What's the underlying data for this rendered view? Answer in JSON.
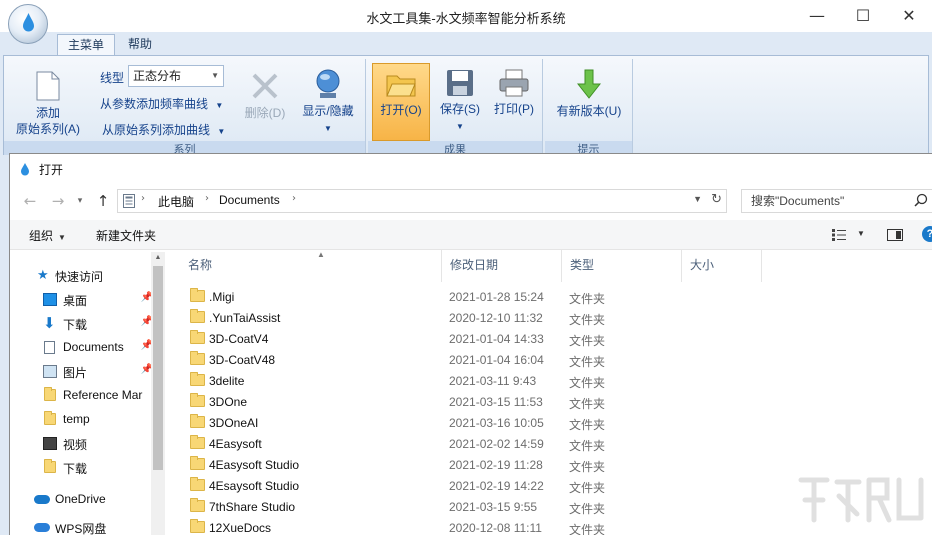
{
  "app": {
    "title": "水文工具集-水文频率智能分析系统",
    "window_controls": {
      "minimize": "—",
      "maximize": "☐",
      "close": "✕"
    },
    "tabs": [
      {
        "label": "主菜单",
        "active": true
      },
      {
        "label": "帮助",
        "active": false
      }
    ],
    "ribbon": {
      "add_button": {
        "line1": "添加",
        "line2": "原始系列(A)"
      },
      "line_type_label": "线型",
      "line_type_value": "正态分布",
      "add_from_params": "从参数添加频率曲线",
      "add_from_series": "从原始系列添加曲线",
      "delete_button": "删除(D)",
      "show_hide_button": "显示/隐藏",
      "group_series": "系列",
      "open_button": "打开(O)",
      "save_button": "保存(S)",
      "print_button": "打印(P)",
      "group_results": "成果",
      "update_button": "有新版本(U)",
      "group_tips": "提示"
    }
  },
  "dialog": {
    "title": "打开",
    "breadcrumb": [
      "此电脑",
      "Documents"
    ],
    "search_placeholder": "搜索\"Documents\"",
    "organize_label": "组织",
    "new_folder_label": "新建文件夹",
    "nav_pane": {
      "items": [
        {
          "label": "快速访问",
          "icon": "star-icon",
          "pinned": false
        },
        {
          "label": "桌面",
          "icon": "desktop-icon",
          "pinned": true
        },
        {
          "label": "下载",
          "icon": "download-icon",
          "pinned": true
        },
        {
          "label": "Documents",
          "icon": "document-icon",
          "pinned": true
        },
        {
          "label": "图片",
          "icon": "picture-icon",
          "pinned": true
        },
        {
          "label": "Reference Mar",
          "icon": "folder-icon",
          "pinned": false
        },
        {
          "label": "temp",
          "icon": "folder-icon",
          "pinned": false
        },
        {
          "label": "视频",
          "icon": "video-icon",
          "pinned": false
        },
        {
          "label": "下载",
          "icon": "folder-icon",
          "pinned": false
        },
        {
          "label": "OneDrive",
          "icon": "cloud-icon",
          "pinned": false
        },
        {
          "label": "WPS网盘",
          "icon": "cloud-icon",
          "pinned": false
        }
      ]
    },
    "columns": {
      "name": "名称",
      "date": "修改日期",
      "type": "类型",
      "size": "大小"
    },
    "files": [
      {
        "name": ".Migi",
        "date": "2021-01-28 15:24",
        "type": "文件夹"
      },
      {
        "name": ".YunTaiAssist",
        "date": "2020-12-10 11:32",
        "type": "文件夹"
      },
      {
        "name": "3D-CoatV4",
        "date": "2021-01-04 14:33",
        "type": "文件夹"
      },
      {
        "name": "3D-CoatV48",
        "date": "2021-01-04 16:04",
        "type": "文件夹"
      },
      {
        "name": "3delite",
        "date": "2021-03-11 9:43",
        "type": "文件夹"
      },
      {
        "name": "3DOne",
        "date": "2021-03-15 11:53",
        "type": "文件夹"
      },
      {
        "name": "3DOneAI",
        "date": "2021-03-16 10:05",
        "type": "文件夹"
      },
      {
        "name": "4Easysoft",
        "date": "2021-02-02 14:59",
        "type": "文件夹"
      },
      {
        "name": "4Easysoft Studio",
        "date": "2021-02-19 11:28",
        "type": "文件夹"
      },
      {
        "name": "4Esaysoft Studio",
        "date": "2021-02-19 14:22",
        "type": "文件夹"
      },
      {
        "name": "7thShare Studio",
        "date": "2021-03-15 9:55",
        "type": "文件夹"
      },
      {
        "name": "12XueDocs",
        "date": "2020-12-08 11:11",
        "type": "文件夹"
      }
    ]
  },
  "colors": {
    "accent": "#1979ca",
    "folder": "#f8d775",
    "ribbon_bg": "#dfe9f5",
    "open_highlight": "#f7b447"
  }
}
